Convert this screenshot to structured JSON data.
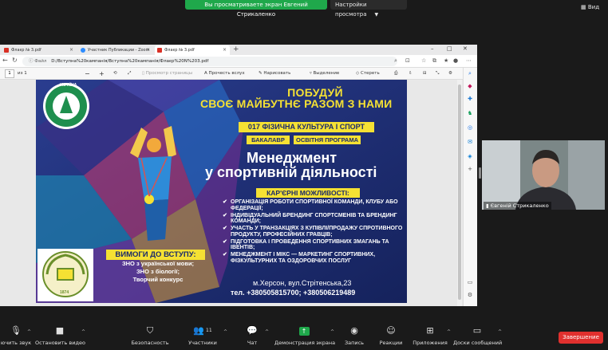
{
  "zoom_top": {
    "share_notice": "Вы просматриваете экран Евгений Стрикаленко",
    "view_settings": "Настройки просмотра",
    "view_button": "Вид"
  },
  "browser": {
    "tabs": [
      {
        "label": "Флаєр № 3.pdf",
        "icon": "pdf-icon",
        "color": "#d93025"
      },
      {
        "label": "Участник Публикации - Zoom",
        "icon": "zoom-icon",
        "color": "#2d8cff"
      },
      {
        "label": "Флаєр № 3.pdf",
        "icon": "pdf-icon",
        "color": "#d93025"
      }
    ],
    "url_prefix": "Файл",
    "url": "D:/Вступна%20кампанія/Вступна%20кампанія/Флаєр%20N%203.pdf",
    "pdf_toolbar": {
      "page": "1",
      "page_total": "из 1",
      "page_view": "Просмотр страницы",
      "read_aloud": "Прочесть вслух",
      "draw": "Нарисовать",
      "highlight": "Выделение",
      "erase": "Стереть"
    }
  },
  "flyer": {
    "title_line1": "ПОБУДУЙ",
    "title_line2": "СВОЄ МАЙБУТНЄ РАЗОМ З НАМИ",
    "specialty": "017 ФІЗИЧНА КУЛЬТУРА І СПОРТ",
    "degree": "БАКАЛАВР",
    "program": "ОСВІТНЯ ПРОГРАМА",
    "program_name_line1": "Менеджмент",
    "program_name_line2": "у спортивній діяльності",
    "careers_title": "КАР'ЄРНІ МОЖЛИВОСТІ:",
    "careers": [
      "ОРГАНІЗАЦІЯ РОБОТИ СПОРТИВНОЇ КОМАНДИ, КЛУБУ АБО ФЕДЕРАЦІЇ;",
      "ІНДИВІДУАЛЬНИЙ БРЕНДИНГ СПОРТСМЕНІВ ТА БРЕНДИНГ КОМАНДИ;",
      "УЧАСТЬ У ТРАНЗАКЦІЯХ З КУПІВЛІ/ПРОДАЖУ СПРОТИВНОГО ПРОДУКТУ, ПРОФЕСІЙНИХ ГРАВЦІВ;",
      "ПІДГОТОВКА І ПРОВЕДЕННЯ СПОРТИВНИХ ЗМАГАНЬ ТА ІВЕНТІВ;",
      "МЕНЕДЖМЕНТ І МІКС — МАРКЕТИНГ СПОРТИВНИХ, ФІЗКУЛЬТУРНИХ ТА ОЗДОРОВЧИХ ПОСЛУГ"
    ],
    "requirements_title": "ВИМОГИ ДО ВСТУПУ:",
    "requirements": [
      "ЗНО з української мови;",
      "ЗНО з біології;",
      "Творчий конкурс"
    ],
    "address": "м.Херсон, вул.Стрітенська,23",
    "phones": "тел. +380505815700; +380506219489",
    "logo_text_top": "УКРАЇНА",
    "logo_year": "1874"
  },
  "camera": {
    "participant_name": "Євгеній Стрикаленко"
  },
  "zoom_bottom": {
    "items": [
      {
        "label": "ючить звук",
        "icon": "microphone-icon"
      },
      {
        "label": "Остановить видео",
        "icon": "video-camera-icon"
      },
      {
        "label": "Безопасность",
        "icon": "shield-icon"
      },
      {
        "label": "Участники",
        "icon": "participants-icon",
        "count": "11"
      },
      {
        "label": "Чат",
        "icon": "chat-icon"
      },
      {
        "label": "Демонстрация экрана",
        "icon": "share-screen-icon"
      },
      {
        "label": "Запись",
        "icon": "record-icon"
      },
      {
        "label": "Реакции",
        "icon": "reactions-icon"
      },
      {
        "label": "Приложения",
        "icon": "apps-icon"
      },
      {
        "label": "Доски сообщений",
        "icon": "whiteboard-icon"
      }
    ],
    "end_button": "Завершение"
  }
}
